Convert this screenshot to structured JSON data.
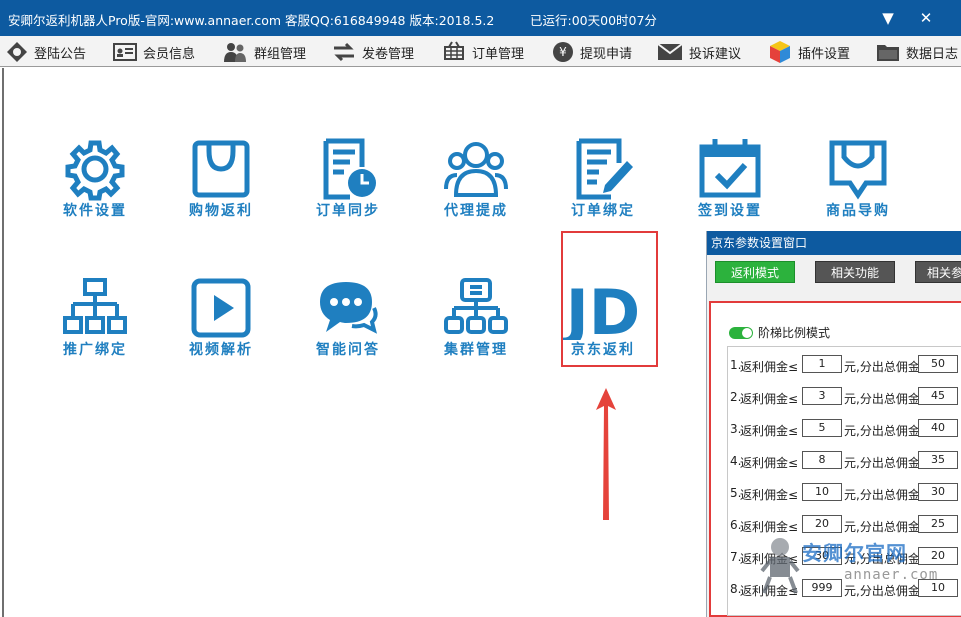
{
  "window": {
    "title": "安卿尔返利机器人Pro版-官网:www.annaer.com 客服QQ:616849948 版本:2018.5.2",
    "runtime": "已运行:00天00时07分",
    "minimize_glyph": "▼",
    "close_glyph": "✕"
  },
  "toolbar": {
    "items": [
      {
        "label": "登陆公告",
        "icon": "gear-diamond-icon"
      },
      {
        "label": "会员信息",
        "icon": "id-card-icon"
      },
      {
        "label": "群组管理",
        "icon": "group-icon"
      },
      {
        "label": "发卷管理",
        "icon": "swap-arrows-icon"
      },
      {
        "label": "订单管理",
        "icon": "cart-icon"
      },
      {
        "label": "提现申请",
        "icon": "yen-coin-icon"
      },
      {
        "label": "投诉建议",
        "icon": "mail-icon"
      },
      {
        "label": "插件设置",
        "icon": "cube-icon"
      },
      {
        "label": "数据日志",
        "icon": "folder-icon"
      }
    ]
  },
  "apps": {
    "row1": [
      {
        "label": "软件设置",
        "icon": "gear-icon"
      },
      {
        "label": "购物返利",
        "icon": "shopping-bag-icon"
      },
      {
        "label": "订单同步",
        "icon": "doc-clock-icon"
      },
      {
        "label": "代理提成",
        "icon": "people-icon"
      },
      {
        "label": "订单绑定",
        "icon": "doc-pen-icon"
      },
      {
        "label": "签到设置",
        "icon": "calendar-check-icon"
      },
      {
        "label": "商品导购",
        "icon": "chat-smile-icon"
      }
    ],
    "row2": [
      {
        "label": "推广绑定",
        "icon": "hierarchy-icon"
      },
      {
        "label": "视频解析",
        "icon": "play-icon"
      },
      {
        "label": "智能问答",
        "icon": "chat-bubbles-icon"
      },
      {
        "label": "集群管理",
        "icon": "cluster-icon"
      },
      {
        "label": "京东返利",
        "icon": "jd-logo-icon",
        "logo_text": "JD"
      }
    ]
  },
  "dialog": {
    "title": "京东参数设置窗口",
    "tabs": [
      "返利模式",
      "相关功能",
      "相关参"
    ],
    "toggle_label": "阶梯比例模式",
    "tier_prefix": "返利佣金≤",
    "tier_mid": "元,分出总佣金",
    "tiers": [
      {
        "num": "1.",
        "amount": "1",
        "percent": "50"
      },
      {
        "num": "2.",
        "amount": "3",
        "percent": "45"
      },
      {
        "num": "3.",
        "amount": "5",
        "percent": "40"
      },
      {
        "num": "4.",
        "amount": "8",
        "percent": "35"
      },
      {
        "num": "5.",
        "amount": "10",
        "percent": "30"
      },
      {
        "num": "6.",
        "amount": "20",
        "percent": "25"
      },
      {
        "num": "7.",
        "amount": "30",
        "percent": "20"
      },
      {
        "num": "8.",
        "amount": "999",
        "percent": "10"
      }
    ]
  },
  "watermark": {
    "text": "安卿尔官网",
    "sub": "annaer.com"
  },
  "colors": {
    "brand_blue": "#0d5aa0",
    "icon_blue": "#1f7fc0",
    "highlight_red": "#e23b3b",
    "active_green": "#2cb23d"
  }
}
